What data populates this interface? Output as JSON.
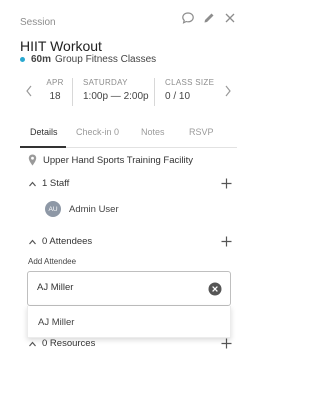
{
  "header": {
    "label": "Session"
  },
  "event": {
    "title": "HIIT Workout",
    "duration": "60m",
    "category": "Group Fitness Classes",
    "color": "#2aa8d0"
  },
  "datebar": {
    "month": "APR",
    "day": "18",
    "weekday": "SATURDAY",
    "time": "1:00p — 2:00p",
    "size_label": "CLASS SIZE",
    "size_value": "0 / 10"
  },
  "tabs": [
    {
      "label": "Details"
    },
    {
      "label": "Check-in 0"
    },
    {
      "label": "Notes"
    },
    {
      "label": "RSVP"
    }
  ],
  "location": "Upper Hand Sports Training Facility",
  "staff_section": {
    "label": "1 Staff"
  },
  "staff": [
    {
      "initials": "AU",
      "name": "Admin User"
    }
  ],
  "attendees_section": {
    "label": "0 Attendees"
  },
  "add_attendee": {
    "label": "Add Attendee",
    "value": "AJ Miller",
    "suggestions": [
      "AJ Miller"
    ]
  },
  "resources_section": {
    "label": "0 Resources"
  },
  "icons": {
    "comment": "comment-icon",
    "edit": "pencil-icon",
    "close": "close-icon",
    "location": "map-pin-icon"
  }
}
